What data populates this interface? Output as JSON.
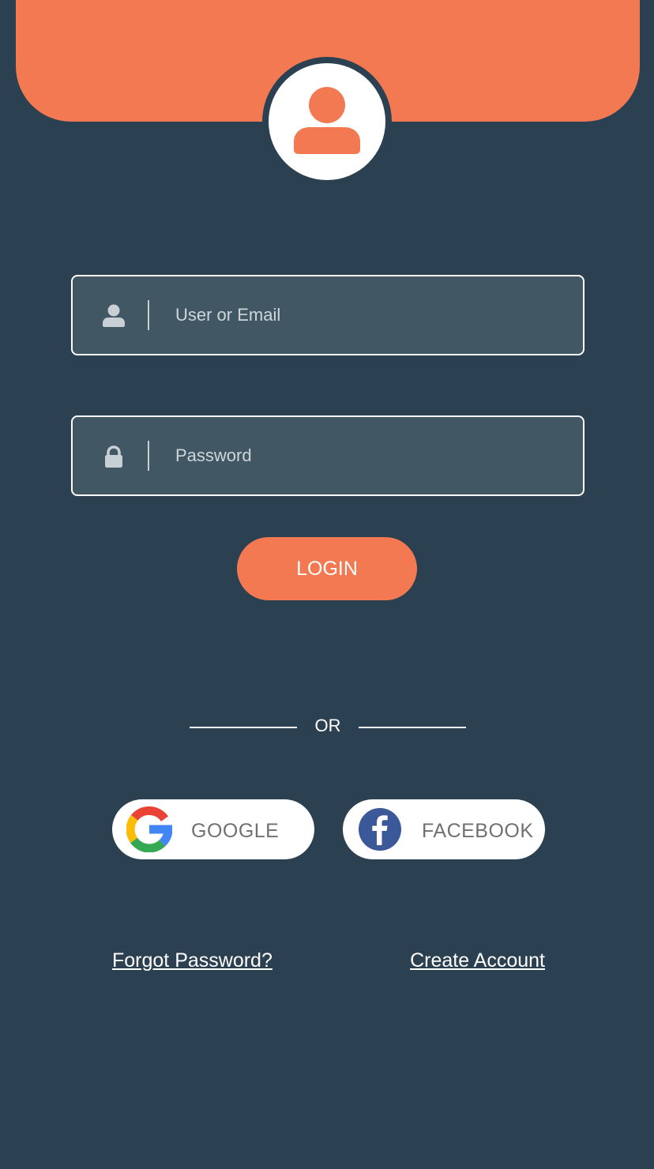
{
  "colors": {
    "background": "#2b4050",
    "accent": "#f37953",
    "field_background": "#415764",
    "facebook_blue": "#3b5998"
  },
  "header": {
    "avatar_icon": "user-icon"
  },
  "form": {
    "user_field": {
      "icon": "user-icon",
      "placeholder": "User or Email",
      "value": ""
    },
    "password_field": {
      "icon": "lock-icon",
      "placeholder": "Password",
      "value": ""
    },
    "login_label": "LOGIN"
  },
  "divider": {
    "label": "OR"
  },
  "social": {
    "google": {
      "icon": "google-icon",
      "label": "GOOGLE"
    },
    "facebook": {
      "icon": "facebook-icon",
      "label": "FACEBOOK"
    }
  },
  "links": {
    "forgot_password": "Forgot Password?",
    "create_account": "Create Account"
  }
}
